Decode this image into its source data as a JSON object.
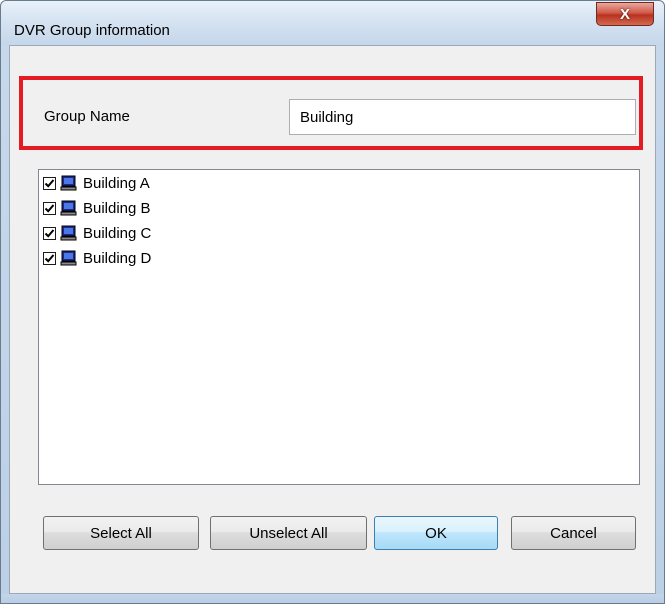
{
  "window": {
    "title": "DVR Group information",
    "close_glyph": "X"
  },
  "group_name": {
    "label": "Group Name",
    "value": "Building"
  },
  "highlight_color": "#e41b23",
  "dvr_list": {
    "items": [
      {
        "label": "Building A",
        "checked": true,
        "icon": "dvr-monitor-icon"
      },
      {
        "label": "Building B",
        "checked": true,
        "icon": "dvr-monitor-icon"
      },
      {
        "label": "Building C",
        "checked": true,
        "icon": "dvr-monitor-icon"
      },
      {
        "label": "Building D",
        "checked": true,
        "icon": "dvr-monitor-icon"
      }
    ]
  },
  "buttons": {
    "select_all": "Select All",
    "unselect_all": "Unselect All",
    "ok": "OK",
    "cancel": "Cancel"
  }
}
